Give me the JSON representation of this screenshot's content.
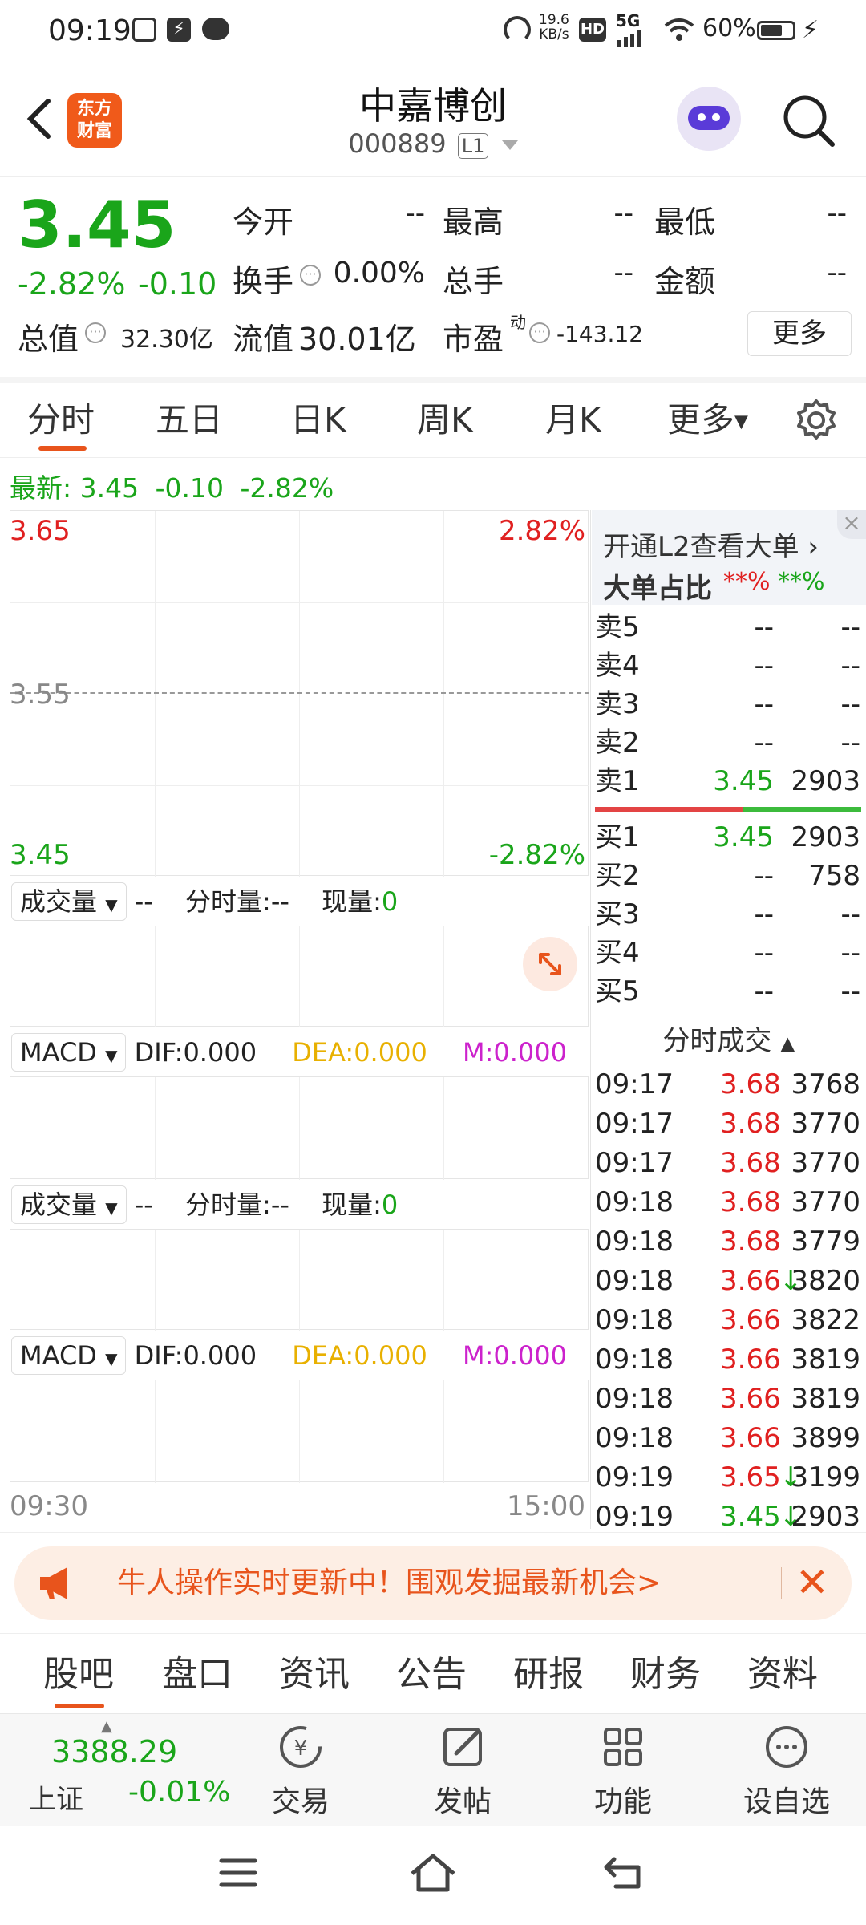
{
  "status_bar": {
    "time": "09:19",
    "net_speed_value": "19.6",
    "net_speed_unit": "KB/s",
    "hd": "HD",
    "signal": "5G",
    "battery": "60%"
  },
  "header": {
    "logo_line1": "东方",
    "logo_line2": "财富",
    "stock_name": "中嘉博创",
    "stock_code": "000889",
    "level_badge": "L1"
  },
  "quote": {
    "price": "3.45",
    "change_pct": "-2.82%",
    "change_amt": "-0.10",
    "open_label": "今开",
    "open_val": "--",
    "high_label": "最高",
    "high_val": "--",
    "low_label": "最低",
    "low_val": "--",
    "turnover_label": "换手",
    "turnover_val": "0.00%",
    "total_hands_label": "总手",
    "total_hands_val": "--",
    "amount_label": "金额",
    "amount_val": "--",
    "market_cap_label": "总值",
    "market_cap_val": "32.30亿",
    "float_cap_label": "流值",
    "float_cap_val": "30.01亿",
    "pe_label": "市盈",
    "pe_sup": "动",
    "pe_val": "-143.12",
    "more_button": "更多"
  },
  "chart_tabs": [
    "分时",
    "五日",
    "日K",
    "周K",
    "月K",
    "更多"
  ],
  "latest": {
    "label": "最新:",
    "price": "3.45",
    "change": "-0.10",
    "pct": "-2.82%"
  },
  "chart": {
    "y_top": "3.65",
    "y_mid": "3.55",
    "y_bottom": "3.45",
    "pct_top": "2.82%",
    "pct_bottom": "-2.82%",
    "time_start": "09:30",
    "time_end": "15:00"
  },
  "indicators": {
    "volume_select": "成交量",
    "volume_dash": "--",
    "fenshi_label": "分时量:",
    "fenshi_val": "--",
    "now_label": "现量:",
    "now_val": "0",
    "macd_select": "MACD",
    "dif": "DIF:0.000",
    "dea": "DEA:0.000",
    "m": "M:0.000"
  },
  "orderbook": {
    "l2_promo": "开通L2查看大单",
    "big_order_label": "大单占比",
    "big_red": "**%",
    "big_green": "**%",
    "sells": [
      {
        "label": "卖5",
        "price": "--",
        "vol": "--"
      },
      {
        "label": "卖4",
        "price": "--",
        "vol": "--"
      },
      {
        "label": "卖3",
        "price": "--",
        "vol": "--"
      },
      {
        "label": "卖2",
        "price": "--",
        "vol": "--"
      },
      {
        "label": "卖1",
        "price": "3.45",
        "vol": "2903"
      }
    ],
    "buys": [
      {
        "label": "买1",
        "price": "3.45",
        "vol": "2903"
      },
      {
        "label": "买2",
        "price": "--",
        "vol": "758"
      },
      {
        "label": "买3",
        "price": "--",
        "vol": "--"
      },
      {
        "label": "买4",
        "price": "--",
        "vol": "--"
      },
      {
        "label": "买5",
        "price": "--",
        "vol": "--"
      }
    ],
    "trades_header": "分时成交",
    "trades": [
      {
        "time": "09:17",
        "price": "3.68",
        "vol": "3768",
        "color": "red",
        "arrow": ""
      },
      {
        "time": "09:17",
        "price": "3.68",
        "vol": "3770",
        "color": "red",
        "arrow": ""
      },
      {
        "time": "09:17",
        "price": "3.68",
        "vol": "3770",
        "color": "red",
        "arrow": ""
      },
      {
        "time": "09:18",
        "price": "3.68",
        "vol": "3770",
        "color": "red",
        "arrow": ""
      },
      {
        "time": "09:18",
        "price": "3.68",
        "vol": "3779",
        "color": "red",
        "arrow": ""
      },
      {
        "time": "09:18",
        "price": "3.66",
        "vol": "3820",
        "color": "red",
        "arrow": "↓"
      },
      {
        "time": "09:18",
        "price": "3.66",
        "vol": "3822",
        "color": "red",
        "arrow": ""
      },
      {
        "time": "09:18",
        "price": "3.66",
        "vol": "3819",
        "color": "red",
        "arrow": ""
      },
      {
        "time": "09:18",
        "price": "3.66",
        "vol": "3819",
        "color": "red",
        "arrow": ""
      },
      {
        "time": "09:18",
        "price": "3.66",
        "vol": "3899",
        "color": "red",
        "arrow": ""
      },
      {
        "time": "09:19",
        "price": "3.65",
        "vol": "3199",
        "color": "red",
        "arrow": "↓"
      },
      {
        "time": "09:19",
        "price": "3.45",
        "vol": "2903",
        "color": "green",
        "arrow": "↓"
      }
    ]
  },
  "banner": {
    "text": "牛人操作实时更新中！围观发掘最新机会>"
  },
  "bottom_tabs": [
    "股吧",
    "盘口",
    "资讯",
    "公告",
    "研报",
    "财务",
    "资料"
  ],
  "toolbar": {
    "index_value": "3388.29",
    "index_name": "上证",
    "index_change": "-0.01%",
    "trade": "交易",
    "post": "发帖",
    "function": "功能",
    "watchlist": "设自选"
  },
  "colors": {
    "up": "#e02020",
    "down": "#1aa51a",
    "accent": "#e8541c"
  }
}
